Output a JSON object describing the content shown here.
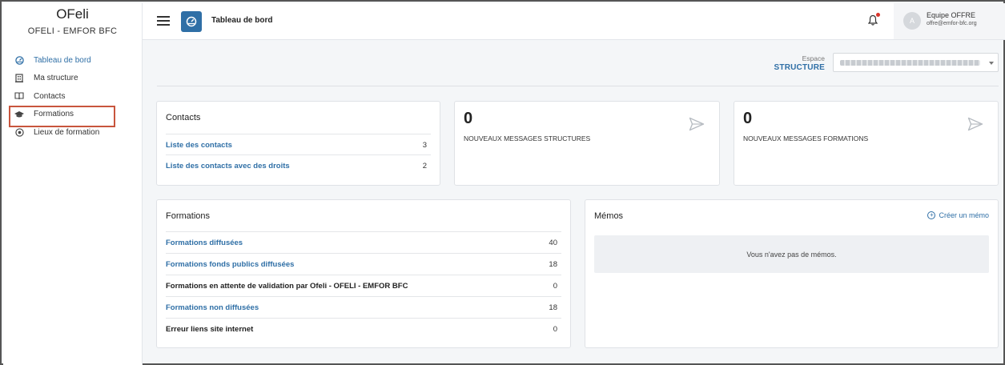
{
  "brand": {
    "title": "OFeli",
    "subtitle": "OFELI - EMFOR BFC"
  },
  "sidebar": {
    "items": [
      {
        "label": "Tableau de bord",
        "icon": "dashboard-icon"
      },
      {
        "label": "Ma structure",
        "icon": "building-icon"
      },
      {
        "label": "Contacts",
        "icon": "address-book-icon"
      },
      {
        "label": "Formations",
        "icon": "graduation-cap-icon"
      },
      {
        "label": "Lieux de formation",
        "icon": "location-icon"
      }
    ]
  },
  "topbar": {
    "title": "Tableau de bord",
    "user": {
      "initial": "A",
      "name": "Equipe OFFRE",
      "email": "offre@emfor-bfc.org"
    }
  },
  "espace": {
    "label": "Espace",
    "value": "STRUCTURE"
  },
  "contacts_card": {
    "title": "Contacts",
    "rows": [
      {
        "label": "Liste des contacts",
        "count": "3"
      },
      {
        "label": "Liste des contacts avec des droits",
        "count": "2"
      }
    ]
  },
  "messages_structures": {
    "count": "0",
    "label": "NOUVEAUX MESSAGES STRUCTURES"
  },
  "messages_formations": {
    "count": "0",
    "label": "NOUVEAUX MESSAGES FORMATIONS"
  },
  "formations_card": {
    "title": "Formations",
    "rows": [
      {
        "label": "Formations diffusées",
        "count": "40"
      },
      {
        "label": "Formations fonds publics diffusées",
        "count": "18"
      },
      {
        "label": "Formations en attente de validation par Ofeli - OFELI - EMFOR BFC",
        "count": "0"
      },
      {
        "label": "Formations non diffusées",
        "count": "18"
      },
      {
        "label": "Erreur liens site internet",
        "count": "0"
      }
    ]
  },
  "memos_card": {
    "title": "Mémos",
    "create_label": "Créer un mémo",
    "empty_text": "Vous n'avez pas de mémos."
  },
  "colors": {
    "accent": "#2f6fa6",
    "highlight": "#c8553d",
    "notification": "#d9342b"
  }
}
